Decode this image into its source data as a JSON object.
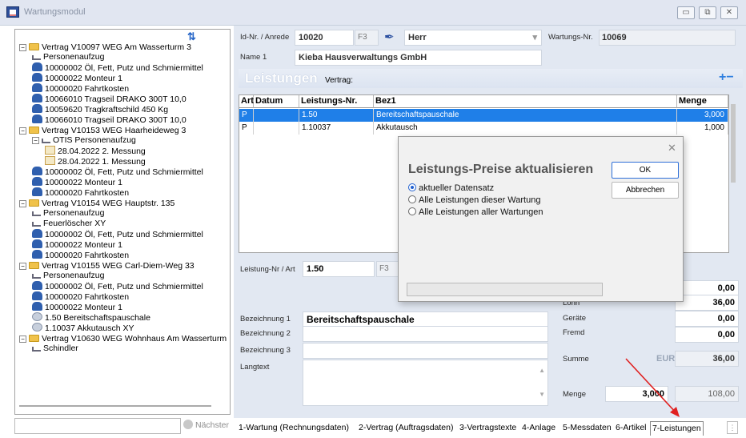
{
  "window": {
    "title": "Wartungsmodul",
    "buttons": [
      "▭",
      "⧉",
      "✕"
    ]
  },
  "tree": {
    "items": [
      {
        "text": "Vertrag V10097 WEG Am Wasserturm 3",
        "icon": "folder-icon",
        "level": 0,
        "expander": "−"
      },
      {
        "text": "Personenaufzug",
        "icon": "elevator-icon",
        "level": 1
      },
      {
        "text": "10000002 Öl, Fett, Putz und Schmiermittel",
        "icon": "person-icon",
        "level": 1
      },
      {
        "text": "10000022 Monteur 1",
        "icon": "person-icon",
        "level": 1
      },
      {
        "text": "10000020 Fahrtkosten",
        "icon": "person-icon",
        "level": 1
      },
      {
        "text": "10066010 Tragseil DRAKO 300T 10,0",
        "icon": "person-icon",
        "level": 1
      },
      {
        "text": "10059620 Tragkraftschild 450 Kg",
        "icon": "person-icon",
        "level": 1
      },
      {
        "text": "10066010 Tragseil DRAKO 300T 10,0",
        "icon": "person-icon",
        "level": 1
      },
      {
        "text": "Vertrag V10153 WEG Haarheideweg 3",
        "icon": "folder-icon",
        "level": 0,
        "expander": "−"
      },
      {
        "text": "OTIS Personenaufzug",
        "icon": "elevator-icon",
        "level": 1,
        "expander": "−"
      },
      {
        "text": "28.04.2022 2. Messung",
        "icon": "measurement-icon",
        "level": 2
      },
      {
        "text": "28.04.2022 1. Messung",
        "icon": "measurement-icon",
        "level": 2
      },
      {
        "text": "10000002 Öl, Fett, Putz und Schmiermittel",
        "icon": "person-icon",
        "level": 1
      },
      {
        "text": "10000022 Monteur 1",
        "icon": "person-icon",
        "level": 1
      },
      {
        "text": "10000020 Fahrtkosten",
        "icon": "person-icon",
        "level": 1
      },
      {
        "text": "Vertrag V10154 WEG Hauptstr. 135",
        "icon": "folder-icon",
        "level": 0,
        "expander": "−"
      },
      {
        "text": "Personenaufzug",
        "icon": "elevator-icon",
        "level": 1
      },
      {
        "text": "Feuerlöscher XY",
        "icon": "elevator-icon",
        "level": 1
      },
      {
        "text": "10000002 Öl, Fett, Putz und Schmiermittel",
        "icon": "person-icon",
        "level": 1
      },
      {
        "text": "10000022 Monteur 1",
        "icon": "person-icon",
        "level": 1
      },
      {
        "text": "10000020 Fahrtkosten",
        "icon": "person-icon",
        "level": 1
      },
      {
        "text": "Vertrag V10155 WEG Carl-Diem-Weg 33",
        "icon": "folder-icon",
        "level": 0,
        "expander": "−"
      },
      {
        "text": "Personenaufzug",
        "icon": "elevator-icon",
        "level": 1
      },
      {
        "text": "10000002 Öl, Fett, Putz und Schmiermittel",
        "icon": "person-icon",
        "level": 1
      },
      {
        "text": "10000020 Fahrtkosten",
        "icon": "person-icon",
        "level": 1
      },
      {
        "text": "10000022 Monteur 1",
        "icon": "person-icon",
        "level": 1
      },
      {
        "text": "1.50 Bereitschaftspauschale",
        "icon": "service-icon",
        "level": 1
      },
      {
        "text": "1.10037 Akkutausch XY",
        "icon": "service-icon",
        "level": 1
      },
      {
        "text": "Vertrag V10630 WEG Wohnhaus Am Wasserturm",
        "icon": "folder-icon",
        "level": 0,
        "expander": "−"
      },
      {
        "text": "Schindler",
        "icon": "elevator-icon",
        "level": 1
      }
    ],
    "next_label": "Nächster"
  },
  "header": {
    "id_label": "Id-Nr. / Anrede",
    "id_value": "10020",
    "f3": "F3",
    "anrede": "Herr",
    "wartungs_label": "Wartungs-Nr.",
    "wartungs_value": "10069",
    "name_label": "Name 1",
    "name_value": "Kieba Hausverwaltungs GmbH"
  },
  "leistungen": {
    "title": "Leistungen",
    "vertrag_label": "Vertrag:",
    "columns": [
      "Art",
      "Datum",
      "Leistungs-Nr.",
      "Bez1",
      "Menge"
    ],
    "rows": [
      {
        "art": "P",
        "datum": "",
        "nr": "1.50",
        "bez": "Bereitschaftspauschale",
        "menge": "3,000",
        "selected": true
      },
      {
        "art": "P",
        "datum": "",
        "nr": "1.10037",
        "bez": "Akkutausch",
        "menge": "1,000",
        "selected": false
      }
    ]
  },
  "detail": {
    "nr_label": "Leistung-Nr / Art",
    "nr_value": "1.50",
    "f3": "F3",
    "bez1_label": "Bezeichnung 1",
    "bez1_value": "Bereitschaftspauschale",
    "bez2_label": "Bezeichnung 2",
    "bez3_label": "Bezeichnung 3",
    "langtext_label": "Langtext",
    "val_top": "0,00",
    "lohn_label": "Lohn",
    "lohn_value": "36,00",
    "geraete_label": "Geräte",
    "geraete_value": "0,00",
    "fremd_label": "Fremd",
    "fremd_value": "0,00",
    "summe_label": "Summe",
    "currency": "EUR",
    "summe_value": "36,00",
    "menge_label": "Menge",
    "menge_value": "3,000",
    "total_value": "108,00"
  },
  "dialog": {
    "title": "Leistungs-Preise aktualisieren",
    "options": [
      "aktueller Datensatz",
      "Alle Leistungen dieser Wartung",
      "Alle Leistungen aller Wartungen"
    ],
    "selected_option": 0,
    "ok_label": "OK",
    "cancel_label": "Abbrechen",
    "close_glyph": "✕"
  },
  "tabs": [
    "1-Wartung (Rechnungsdaten)",
    "2-Vertrag (Auftragsdaten)",
    "3-Vertragstexte",
    "4-Anlage",
    "5-Messdaten",
    "6-Artikel",
    "7-Leistungen"
  ],
  "active_tab": 6,
  "colors": {
    "accent": "#1f7fe8",
    "selection": "#1f7fe8",
    "arrow": "#e02020"
  }
}
